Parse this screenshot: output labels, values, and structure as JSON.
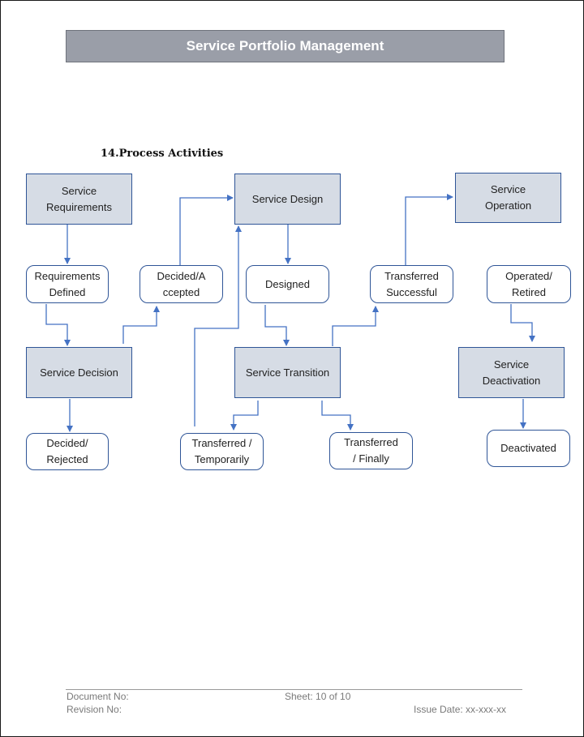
{
  "header": {
    "title": "Service Portfolio Management"
  },
  "section": {
    "heading": "14.Process Activities"
  },
  "diagram": {
    "processes": {
      "service_requirements": "Service\nRequirements",
      "service_design": "Service Design",
      "service_operation": "Service\nOperation",
      "service_decision": "Service Decision",
      "service_transition": "Service Transition",
      "service_deactivation": "Service\nDeactivation"
    },
    "states": {
      "requirements_defined": "Requirements\nDefined",
      "decided_accepted": "Decided/A\nccepted",
      "designed": "Designed",
      "transferred_successful": "Transferred\nSuccessful",
      "operated_retired": "Operated/\nRetired",
      "decided_rejected": "Decided/\nRejected",
      "transferred_temporarily": "Transferred /\nTemporarily",
      "transferred_finally": "Transferred\n/ Finally",
      "deactivated": "Deactivated"
    },
    "connections": [
      [
        "Service Requirements",
        "Requirements Defined"
      ],
      [
        "Requirements Defined",
        "Service Decision"
      ],
      [
        "Service Decision",
        "Decided/Rejected"
      ],
      [
        "Service Decision",
        "Decided/Accepted"
      ],
      [
        "Decided/Accepted",
        "Service Design"
      ],
      [
        "Transferred / Temporarily",
        "Service Design"
      ],
      [
        "Service Design",
        "Designed"
      ],
      [
        "Designed",
        "Service Transition"
      ],
      [
        "Service Transition",
        "Transferred / Temporarily"
      ],
      [
        "Service Transition",
        "Transferred / Finally"
      ],
      [
        "Service Transition",
        "Transferred Successful"
      ],
      [
        "Transferred Successful",
        "Service Operation"
      ],
      [
        "Operated/Retired",
        "Service Deactivation"
      ],
      [
        "Service Deactivation",
        "Deactivated"
      ]
    ],
    "line_color": "#4472c4",
    "process_fill": "#d6dce5",
    "border_color": "#2f5597"
  },
  "footer": {
    "document_no": "Document No:",
    "revision_no": "Revision No:",
    "sheet": "Sheet: 10 of 10",
    "issue_date": "Issue Date: xx-xxx-xx"
  }
}
